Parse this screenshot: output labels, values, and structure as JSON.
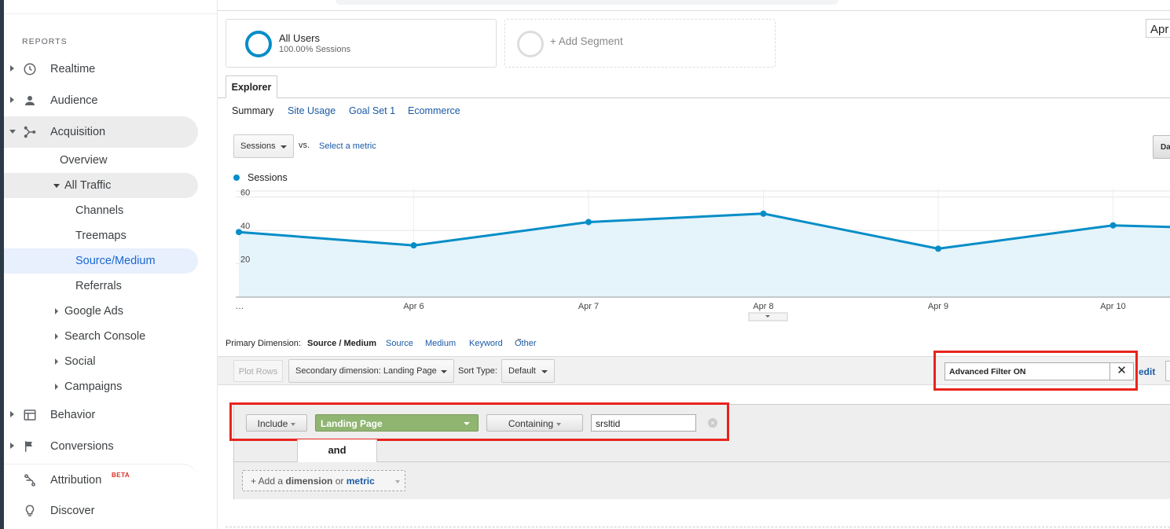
{
  "sidebar": {
    "reports_label": "REPORTS",
    "nav": [
      {
        "label": "Realtime",
        "icon": "clock-icon"
      },
      {
        "label": "Audience",
        "icon": "person-icon"
      },
      {
        "label": "Acquisition",
        "icon": "acquisition-icon"
      },
      {
        "label": "Behavior",
        "icon": "behavior-icon"
      },
      {
        "label": "Conversions",
        "icon": "flag-icon"
      },
      {
        "label": "Attribution",
        "icon": "attribution-icon",
        "badge": "BETA"
      },
      {
        "label": "Discover",
        "icon": "lightbulb-icon"
      }
    ],
    "acquisition_sub": {
      "overview": "Overview",
      "all_traffic": "All Traffic",
      "channels": "Channels",
      "treemaps": "Treemaps",
      "source_medium": "Source/Medium",
      "referrals": "Referrals",
      "google_ads": "Google Ads",
      "search_console": "Search Console",
      "social": "Social",
      "campaigns": "Campaigns"
    }
  },
  "segments": {
    "all_users_title": "All Users",
    "all_users_sub": "100.00% Sessions",
    "add_segment": "+ Add Segment"
  },
  "date_stub": "Apr",
  "tabs": {
    "explorer": "Explorer",
    "subtabs": [
      "Summary",
      "Site Usage",
      "Goal Set 1",
      "Ecommerce"
    ]
  },
  "metric_row": {
    "metric_select": "Sessions",
    "vs": "vs.",
    "select_metric": "Select a metric",
    "day_button": "Da"
  },
  "legend": {
    "series": "Sessions",
    "color": "#058dc7"
  },
  "chart_data": {
    "type": "area",
    "x": [
      "…",
      "Apr 6",
      "Apr 7",
      "Apr 8",
      "Apr 9",
      "Apr 10",
      ""
    ],
    "xticks": [
      "…",
      "Apr 6",
      "Apr 7",
      "Apr 8",
      "Apr 9",
      "Apr 10"
    ],
    "series": [
      {
        "name": "Sessions",
        "values": [
          39,
          31,
          45,
          50,
          29,
          43,
          40
        ]
      }
    ],
    "yticks": [
      20,
      40,
      60
    ],
    "ylim": [
      0,
      65
    ],
    "grid": true,
    "color": "#058dc7"
  },
  "primary_dimension": {
    "label": "Primary Dimension:",
    "current": "Source / Medium",
    "links": [
      "Source",
      "Medium",
      "Keyword",
      "Other"
    ]
  },
  "toolbar": {
    "plot_rows": "Plot Rows",
    "secondary_dimension": "Secondary dimension: Landing Page",
    "sort_type_label": "Sort Type:",
    "sort_type": "Default",
    "advanced_filter": "Advanced Filter ON",
    "close": "✕",
    "edit": "edit"
  },
  "filter": {
    "include": "Include",
    "dimension": "Landing Page",
    "match": "Containing",
    "value": "srsltid",
    "and": "and",
    "add_prefix": "+ Add a ",
    "add_dimension": "dimension",
    "add_or": " or ",
    "add_metric": "metric"
  },
  "highlight_color": "#e8241d"
}
